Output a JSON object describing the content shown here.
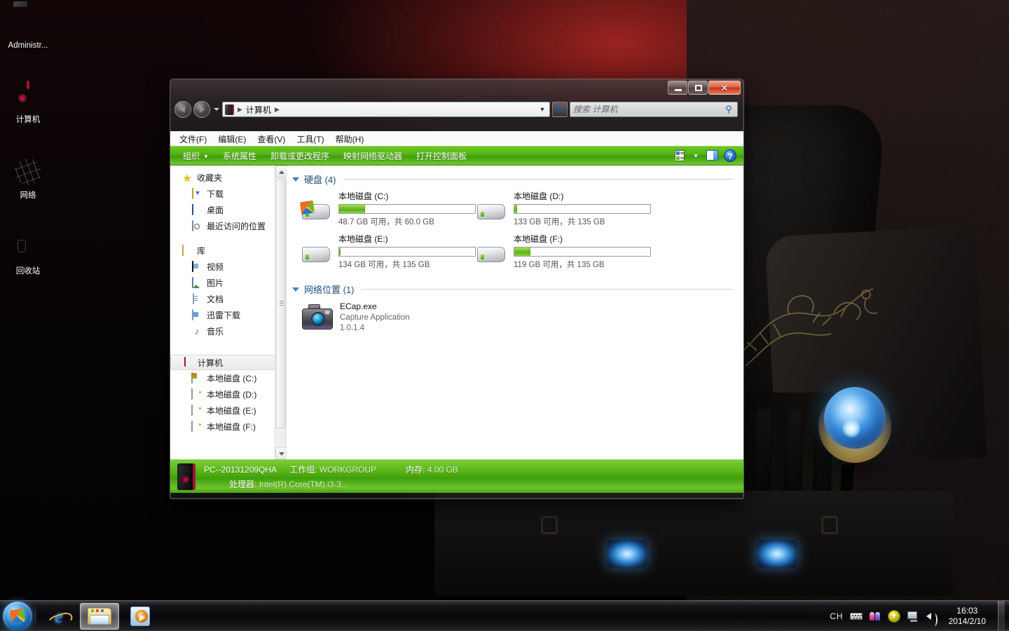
{
  "desktop": {
    "icons": [
      {
        "label": "Administr...",
        "icon": "folder-icon"
      },
      {
        "label": "计算机",
        "icon": "computer-icon"
      },
      {
        "label": "网络",
        "icon": "network-icon"
      },
      {
        "label": "回收站",
        "icon": "recycle-bin-icon"
      }
    ]
  },
  "window": {
    "title_buttons": {
      "minimize": "minimize-icon",
      "maximize": "maximize-icon",
      "close": "✕"
    },
    "address": {
      "breadcrumb": "计算机",
      "sep1": "▶",
      "sep2": "▶",
      "dropdown_caret": "▼",
      "refresh_label": "↻"
    },
    "search": {
      "placeholder": "搜索 计算机",
      "value": "",
      "icon": "search-icon"
    },
    "menu": [
      {
        "label": "文件(F)"
      },
      {
        "label": "编辑(E)"
      },
      {
        "label": "查看(V)"
      },
      {
        "label": "工具(T)"
      },
      {
        "label": "帮助(H)"
      }
    ],
    "toolbar": {
      "organize": "组织",
      "organize_caret": "▼",
      "system_properties": "系统属性",
      "uninstall": "卸载或更改程序",
      "map_drive": "映射网络驱动器",
      "control_panel": "打开控制面板",
      "view_caret": "▼",
      "help_glyph": "?"
    },
    "navpane": {
      "favorites": {
        "label": "收藏夹",
        "icon": "star-icon"
      },
      "favorites_items": [
        {
          "label": "下载",
          "icon": "downloads-icon"
        },
        {
          "label": "桌面",
          "icon": "desktop-icon"
        },
        {
          "label": "最近访问的位置",
          "icon": "recent-places-icon"
        }
      ],
      "libraries": {
        "label": "库",
        "icon": "library-icon"
      },
      "library_items": [
        {
          "label": "视频",
          "icon": "video-icon"
        },
        {
          "label": "图片",
          "icon": "pictures-icon"
        },
        {
          "label": "文档",
          "icon": "documents-icon"
        },
        {
          "label": "迅雷下载",
          "icon": "thunder-download-icon"
        },
        {
          "label": "音乐",
          "icon": "music-icon"
        }
      ],
      "computer": {
        "label": "计算机",
        "icon": "computer-icon"
      },
      "computer_items": [
        {
          "label": "本地磁盘 (C:)",
          "icon": "drive-c-icon"
        },
        {
          "label": "本地磁盘 (D:)",
          "icon": "drive-icon"
        },
        {
          "label": "本地磁盘 (E:)",
          "icon": "drive-icon"
        },
        {
          "label": "本地磁盘 (F:)",
          "icon": "drive-icon"
        }
      ]
    },
    "groups": {
      "hard_disks": {
        "title": "硬盘 (4)"
      },
      "network_locations": {
        "title": "网络位置 (1)"
      }
    },
    "drives": [
      {
        "name": "本地磁盘 (C:)",
        "free": "48.7 GB 可用，共 60.0 GB",
        "used_pct": 19,
        "system": true
      },
      {
        "name": "本地磁盘 (D:)",
        "free": "133 GB 可用，共 135 GB",
        "used_pct": 2,
        "system": false
      },
      {
        "name": "本地磁盘 (E:)",
        "free": "134 GB 可用，共 135 GB",
        "used_pct": 1,
        "system": false
      },
      {
        "name": "本地磁盘 (F:)",
        "free": "119 GB 可用，共 135 GB",
        "used_pct": 12,
        "system": false
      }
    ],
    "network_items": [
      {
        "name": "ECap.exe",
        "description": "Capture Application",
        "version": "1.0.1.4",
        "icon": "camera-icon"
      }
    ],
    "status": {
      "pc_name": "PC--20131209QHA",
      "workgroup_label": "工作组:",
      "workgroup_value": "WORKGROUP",
      "memory_label": "内存:",
      "memory_value": "4.00 GB",
      "processor_label": "处理器:",
      "processor_value": "Intel(R) Core(TM) i3-3..."
    }
  },
  "taskbar": {
    "start": "start-orb-icon",
    "tasks": [
      {
        "icon": "internet-explorer-icon",
        "active": false,
        "glyph": "e"
      },
      {
        "icon": "windows-explorer-icon",
        "active": true
      },
      {
        "icon": "windows-media-player-icon",
        "active": false
      }
    ],
    "tray": {
      "ime": "CH",
      "keyboard": "keyboard-icon",
      "users": "users-icon",
      "security": "security-shield-icon",
      "network": "network-tray-icon",
      "volume": "volume-icon"
    },
    "clock": {
      "time": "16:03",
      "date": "2014/2/10"
    }
  },
  "colors": {
    "toolbar_green": "#57b514",
    "drive_bar_green": "#79c72d",
    "close_red": "#c03a18",
    "group_header_blue": "#1f4e79"
  }
}
